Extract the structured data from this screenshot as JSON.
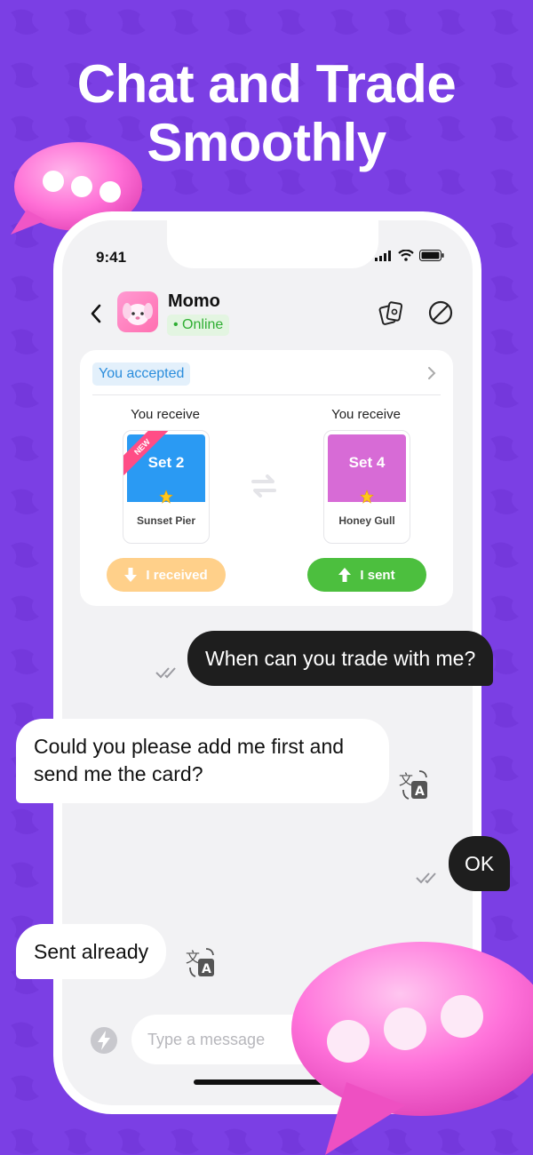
{
  "headline": [
    "Chat and Trade",
    "Smoothly"
  ],
  "status_bar": {
    "time": "9:41"
  },
  "contact": {
    "name": "Momo",
    "status": "• Online"
  },
  "trade": {
    "status": "You accepted",
    "left": {
      "label": "You receive",
      "set": "Set 2",
      "name": "Sunset Pier",
      "ribbon": "NEW",
      "color": "#2a9af3"
    },
    "right": {
      "label": "You receive",
      "set": "Set 4",
      "name": "Honey Gull",
      "color": "#d76bd6"
    },
    "received_button": "I received",
    "sent_button": "I sent"
  },
  "messages": [
    {
      "direction": "out",
      "text": "When can you trade with me?"
    },
    {
      "direction": "in",
      "lines": [
        "Could you please add me first and",
        "send me the card?"
      ]
    },
    {
      "direction": "out",
      "text": "OK"
    },
    {
      "direction": "in",
      "text": "Sent already"
    }
  ],
  "composer": {
    "placeholder": "Type a message"
  },
  "icons": [
    "back-chevron-icon",
    "card-deck-icon",
    "block-icon",
    "double-check-icon",
    "translate-icon",
    "bolt-icon",
    "swap-arrows-icon",
    "star-icon"
  ],
  "colors": {
    "background": "#7b3fe4",
    "online": "#2fae33",
    "accepted": "#2b8ddc",
    "received": "#ffd08a",
    "sent": "#4cbf3e",
    "outgoing_bubble": "#1e1e1e"
  }
}
